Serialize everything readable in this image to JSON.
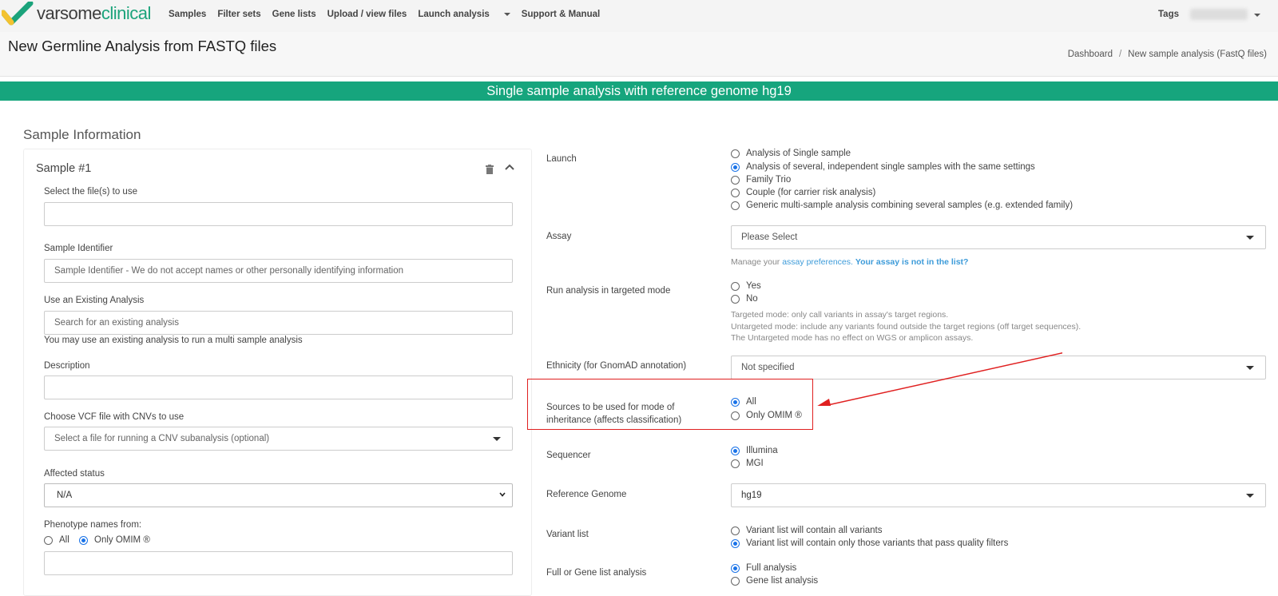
{
  "nav": {
    "logo_a": "varsome",
    "logo_b": "clinical",
    "items": [
      "Samples",
      "Filter sets",
      "Gene lists",
      "Upload / view files",
      "Launch analysis",
      "Support & Manual"
    ],
    "tags": "Tags"
  },
  "header": {
    "title": "New Germline Analysis from FASTQ files",
    "breadcrumb": [
      "Dashboard",
      "New sample analysis (FastQ files)"
    ]
  },
  "banner": "Single sample analysis with reference genome hg19",
  "sample_info": {
    "title": "Sample Information",
    "sample_title": "Sample #1",
    "files_label": "Select the file(s) to use",
    "identifier_label": "Sample Identifier",
    "identifier_placeholder": "Sample Identifier - We do not accept names or other personally identifying information",
    "existing_label": "Use an Existing Analysis",
    "existing_placeholder": "Search for an existing analysis",
    "existing_help": "You may use an existing analysis to run a multi sample analysis",
    "description_label": "Description",
    "vcf_label": "Choose VCF file with CNVs to use",
    "vcf_placeholder": "Select a file for running a CNV subanalysis (optional)",
    "affected_label": "Affected status",
    "affected_value": "N/A",
    "phenotype_label": "Phenotype names from:",
    "phenotype_options": [
      "All",
      "Only OMIM ®"
    ],
    "phenotype_selected": 1
  },
  "settings": {
    "launch_label": "Launch",
    "launch_options": [
      "Analysis of Single sample",
      "Analysis of several, independent single samples with the same settings",
      "Family Trio",
      "Couple (for carrier risk analysis)",
      "Generic multi-sample analysis combining several samples (e.g. extended family)"
    ],
    "launch_selected": 1,
    "assay_label": "Assay",
    "assay_value": "Please Select",
    "assay_help_prefix": "Manage your",
    "assay_help_link": "assay preferences.",
    "assay_help_bold": "Your assay is not in the list?",
    "targeted_label": "Run analysis in targeted mode",
    "targeted_options": [
      "Yes",
      "No"
    ],
    "targeted_help": [
      "Targeted mode: only call variants in assay's target regions.",
      "Untargeted mode: include any variants found outside the target regions (off target sequences).",
      "The Untargeted mode has no effect on WGS or amplicon assays."
    ],
    "ethnicity_label": "Ethnicity (for GnomAD annotation)",
    "ethnicity_value": "Not specified",
    "inheritance_label_1": "Sources to be used for mode of",
    "inheritance_label_2": "inheritance (affects classification)",
    "inheritance_options": [
      "All",
      "Only OMIM ®"
    ],
    "inheritance_selected": 0,
    "sequencer_label": "Sequencer",
    "sequencer_options": [
      "Illumina",
      "MGI"
    ],
    "sequencer_selected": 0,
    "genome_label": "Reference Genome",
    "genome_value": "hg19",
    "variant_label": "Variant list",
    "variant_options": [
      "Variant list will contain all variants",
      "Variant list will contain only those variants that pass quality filters"
    ],
    "variant_selected": 1,
    "gene_label": "Full or Gene list analysis",
    "gene_options": [
      "Full analysis",
      "Gene list analysis"
    ],
    "gene_selected": 0
  },
  "colors": {
    "brand": "#16a57d",
    "radio": "#1a73e8",
    "annotation": "#e02020"
  }
}
